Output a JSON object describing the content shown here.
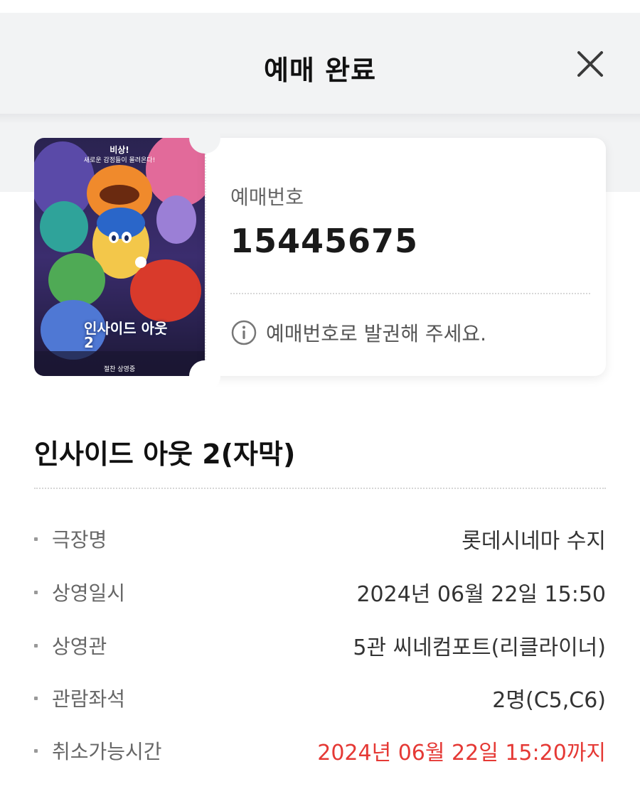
{
  "header": {
    "title": "예매 완료",
    "close_icon": "close-icon"
  },
  "ticket": {
    "reservation_label": "예매번호",
    "reservation_number": "15445675",
    "notice_icon": "info-icon",
    "notice_text": "예매번호로 발권해 주세요.",
    "poster": {
      "tagline_top": "비상!",
      "tagline_sub": "새로운 감정들이 몰려온다!",
      "title_text": "인사이드 아웃2",
      "bottom_text": "절찬 상영중"
    }
  },
  "movie": {
    "title": "인사이드 아웃 2(자막)"
  },
  "details": [
    {
      "label": "극장명",
      "value": "롯데시네마 수지"
    },
    {
      "label": "상영일시",
      "value": "2024년 06월 22일 15:50"
    },
    {
      "label": "상영관",
      "value": "5관 씨네컴포트(리클라이너)"
    },
    {
      "label": "관람좌석",
      "value": "2명(C5,C6)"
    },
    {
      "label": "취소가능시간",
      "value": "2024년 06월 22일 15:20까지"
    }
  ],
  "colors": {
    "header_bg": "#f2f3f4",
    "accent_red": "#e53935"
  }
}
